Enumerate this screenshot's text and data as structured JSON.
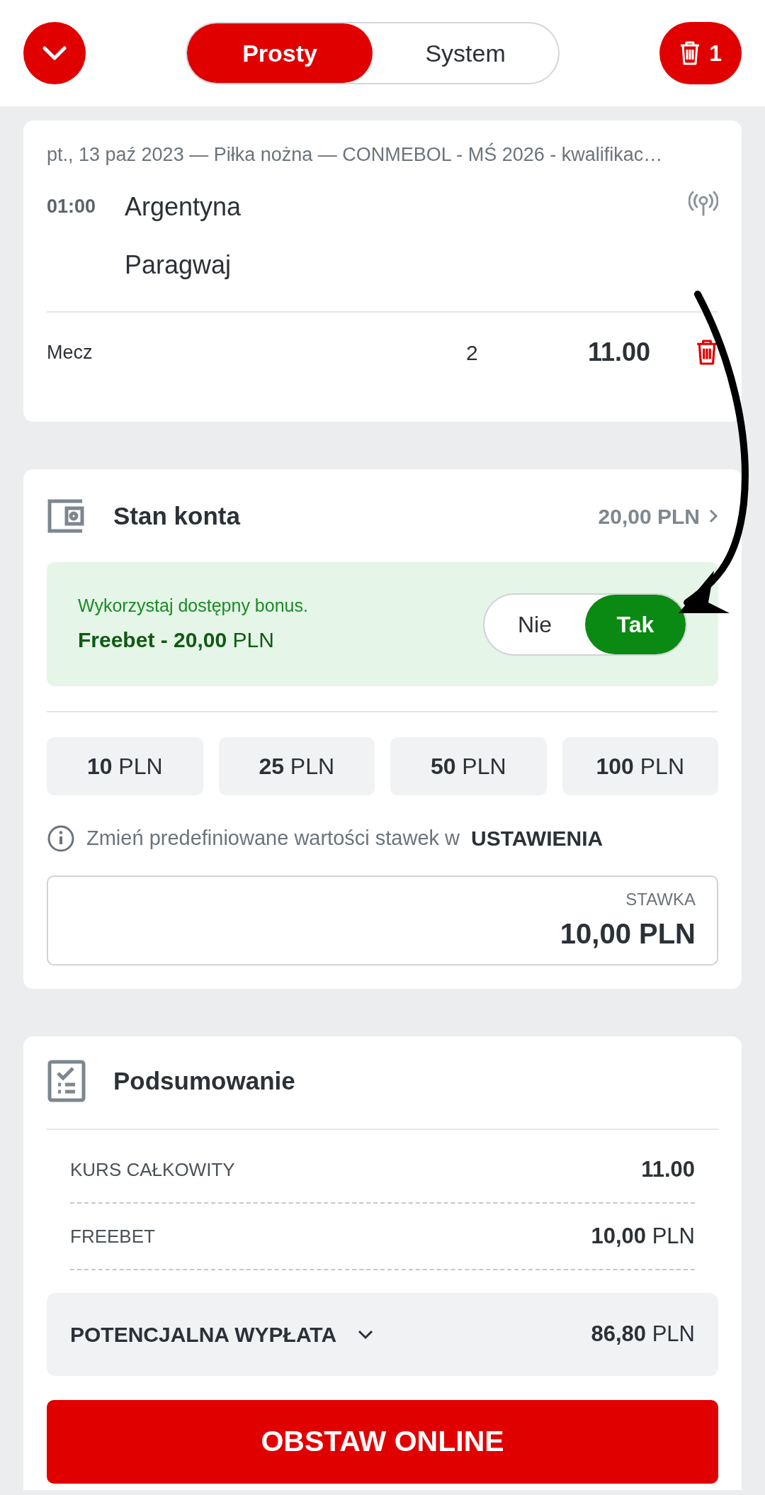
{
  "header": {
    "tabs": [
      {
        "label": "Prosty",
        "selected": true
      },
      {
        "label": "System",
        "selected": false
      }
    ],
    "bet_count": "1"
  },
  "event": {
    "meta": "pt., 13 paź 2023 — Piłka nożna — CONMEBOL - MŚ 2026 - kwalifikac…",
    "time": "01:00",
    "teams": [
      "Argentyna",
      "Paragwaj"
    ],
    "market": "Mecz",
    "pick": "2",
    "odds": "11.00"
  },
  "balance": {
    "title": "Stan konta",
    "amount": "20,00 PLN",
    "bonus": {
      "hint": "Wykorzystaj dostępny bonus.",
      "offer": "**Freebet - 20,00** PLN",
      "options": [
        {
          "label": "Nie",
          "selected": false
        },
        {
          "label": "Tak",
          "selected": true
        }
      ]
    },
    "presets": [
      "**10** PLN",
      "**25** PLN",
      "**50** PLN",
      "**100** PLN"
    ],
    "info": "Zmień predefiniowane wartości stawek w",
    "info_link": "USTAWIENIA",
    "stake": {
      "label": "STAWKA",
      "value": "10,00 PLN"
    }
  },
  "summary": {
    "title": "Podsumowanie",
    "rows": [
      {
        "label": "KURS CAŁKOWITY",
        "value": "**11.00**"
      },
      {
        "label": "FREEBET",
        "value": "**10,00** PLN"
      }
    ],
    "payout": {
      "label": "POTENCJALNA WYPŁATA",
      "value": "**86,80** PLN"
    },
    "submit": "OBSTAW ONLINE"
  }
}
